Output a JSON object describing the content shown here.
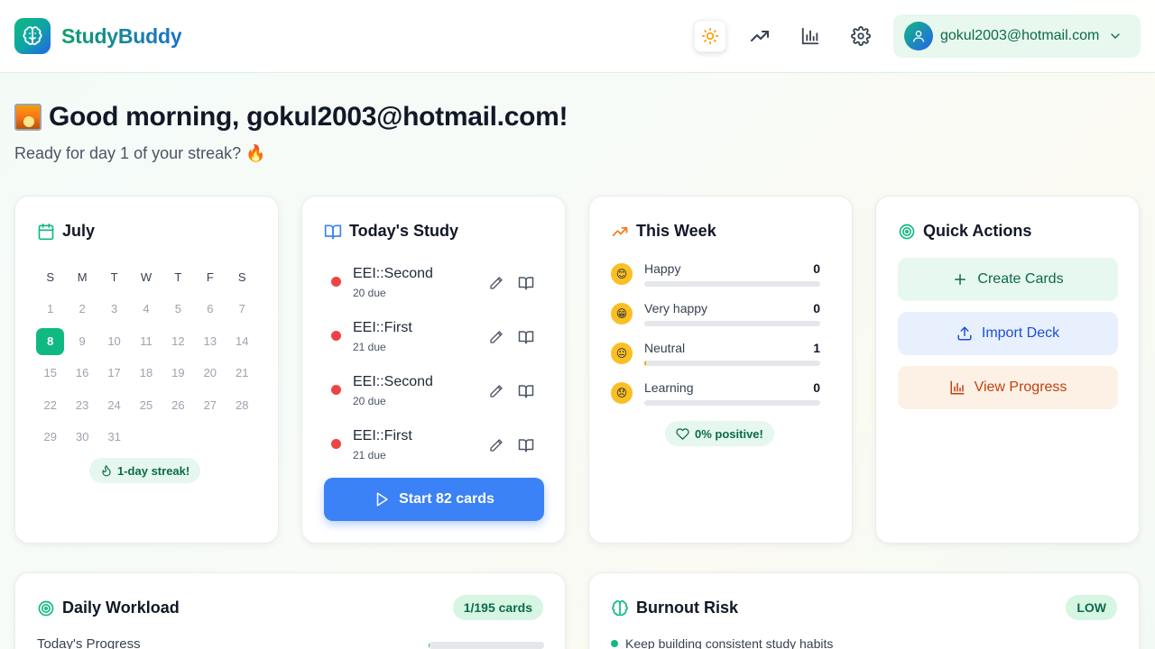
{
  "app": {
    "name": "StudyBuddy"
  },
  "header": {
    "buttons": [
      "sun-icon",
      "trending-up-icon",
      "bar-chart-icon",
      "gear-icon"
    ],
    "user_email": "gokul2003@hotmail.com"
  },
  "greeting": {
    "title": "Good morning, gokul2003@hotmail.com!",
    "subtitle": "Ready for day 1 of your streak? 🔥"
  },
  "calendar": {
    "title": "July",
    "weekdays": [
      "S",
      "M",
      "T",
      "W",
      "T",
      "F",
      "S"
    ],
    "weeks": [
      [
        "1",
        "2",
        "3",
        "4",
        "5",
        "6",
        "7"
      ],
      [
        "8",
        "9",
        "10",
        "11",
        "12",
        "13",
        "14"
      ],
      [
        "15",
        "16",
        "17",
        "18",
        "19",
        "20",
        "21"
      ],
      [
        "22",
        "23",
        "24",
        "25",
        "26",
        "27",
        "28"
      ],
      [
        "29",
        "30",
        "31"
      ]
    ],
    "today": "8",
    "streak_label": "1-day streak!",
    "accent": "#10b981"
  },
  "today_study": {
    "title": "Today's Study",
    "decks": [
      {
        "name": "EEI::Second",
        "due": "20 due"
      },
      {
        "name": "EEI::First",
        "due": "21 due"
      },
      {
        "name": "EEI::Second",
        "due": "20 due"
      },
      {
        "name": "EEI::First",
        "due": "21 due"
      }
    ],
    "start_label": "Start 82 cards",
    "accent": "#3b82f6"
  },
  "this_week": {
    "title": "This Week",
    "moods": [
      {
        "emoji": "😊",
        "label": "Happy",
        "count": "0",
        "fraction": 0
      },
      {
        "emoji": "😁",
        "label": "Very happy",
        "count": "0",
        "fraction": 0
      },
      {
        "emoji": "😐",
        "label": "Neutral",
        "count": "1",
        "fraction": 0.01
      },
      {
        "emoji": "😞",
        "label": "Learning",
        "count": "0",
        "fraction": 0
      }
    ],
    "positive_label": "0% positive!"
  },
  "quick_actions": {
    "title": "Quick Actions",
    "items": [
      {
        "label": "Create Cards",
        "icon": "plus-icon",
        "bg": "#e6f8ef",
        "color": "#0b6b48"
      },
      {
        "label": "Import Deck",
        "icon": "upload-icon",
        "bg": "#e8f0fe",
        "color": "#1d4ed8"
      },
      {
        "label": "View Progress",
        "icon": "bar-chart-icon",
        "bg": "#fdf1e6",
        "color": "#c2410c"
      }
    ]
  },
  "daily_workload": {
    "title": "Daily Workload",
    "badge": "1/195 cards",
    "progress_label": "Today's Progress",
    "progress_fraction": 0.005
  },
  "burnout": {
    "title": "Burnout Risk",
    "badge": "LOW",
    "tip": "Keep building consistent study habits"
  }
}
